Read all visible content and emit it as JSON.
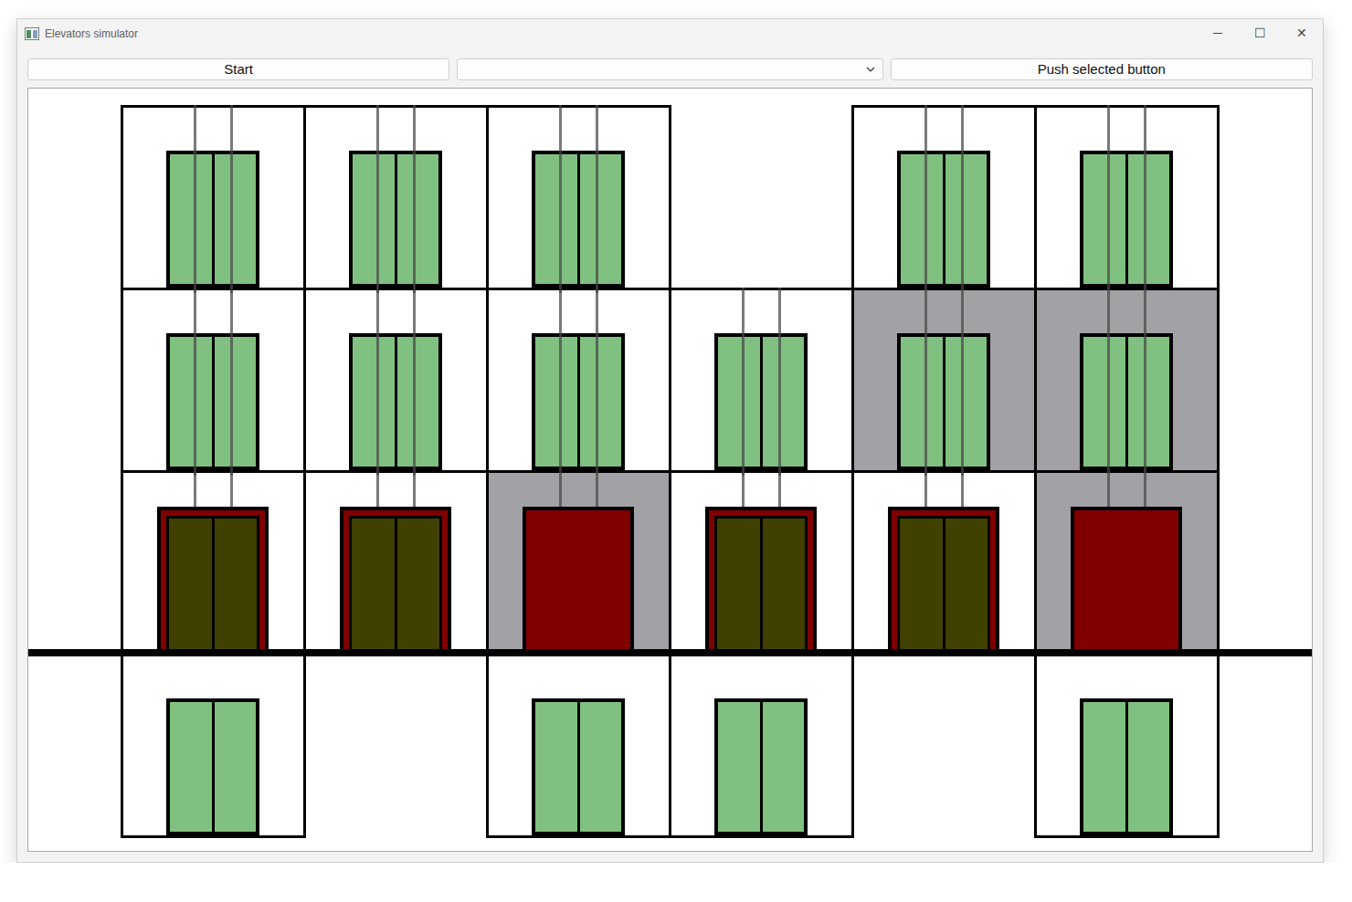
{
  "window": {
    "title": "Elevators simulator",
    "controls": [
      "─",
      "☐",
      "✕"
    ]
  },
  "toolbar": {
    "start_button": "Start",
    "combo": {
      "value": ""
    },
    "push_button": "Push selected button"
  },
  "building": {
    "elevators": [
      {
        "floors": [
          {
            "exists": true,
            "highlighted": false,
            "underground": false
          },
          {
            "exists": true,
            "highlighted": false,
            "underground": false
          },
          {
            "exists": true,
            "highlighted": false,
            "underground": false
          },
          {
            "exists": true,
            "highlighted": false,
            "underground": true
          }
        ],
        "cabin": {
          "floor": 2,
          "doors_open": false
        }
      },
      {
        "floors": [
          {
            "exists": true,
            "highlighted": false,
            "underground": false
          },
          {
            "exists": true,
            "highlighted": false,
            "underground": false
          },
          {
            "exists": true,
            "highlighted": false,
            "underground": false
          },
          {
            "exists": false,
            "highlighted": false,
            "underground": true
          }
        ],
        "cabin": {
          "floor": 2,
          "doors_open": false
        }
      },
      {
        "floors": [
          {
            "exists": true,
            "highlighted": false,
            "underground": false
          },
          {
            "exists": true,
            "highlighted": false,
            "underground": false
          },
          {
            "exists": true,
            "highlighted": true,
            "underground": false
          },
          {
            "exists": true,
            "highlighted": false,
            "underground": true
          }
        ],
        "cabin": {
          "floor": 2,
          "doors_open": true
        }
      },
      {
        "floors": [
          {
            "exists": false,
            "highlighted": false,
            "underground": false
          },
          {
            "exists": true,
            "highlighted": false,
            "underground": false
          },
          {
            "exists": true,
            "highlighted": false,
            "underground": false
          },
          {
            "exists": true,
            "highlighted": false,
            "underground": true
          }
        ],
        "cabin": {
          "floor": 2,
          "doors_open": false
        }
      },
      {
        "floors": [
          {
            "exists": true,
            "highlighted": false,
            "underground": false
          },
          {
            "exists": true,
            "highlighted": true,
            "underground": false
          },
          {
            "exists": true,
            "highlighted": false,
            "underground": false
          },
          {
            "exists": false,
            "highlighted": false,
            "underground": true
          }
        ],
        "cabin": {
          "floor": 2,
          "doors_open": false
        }
      },
      {
        "floors": [
          {
            "exists": true,
            "highlighted": false,
            "underground": false
          },
          {
            "exists": true,
            "highlighted": true,
            "underground": false
          },
          {
            "exists": true,
            "highlighted": true,
            "underground": false
          },
          {
            "exists": true,
            "highlighted": false,
            "underground": true
          }
        ],
        "cabin": {
          "floor": 2,
          "doors_open": true
        }
      }
    ]
  }
}
